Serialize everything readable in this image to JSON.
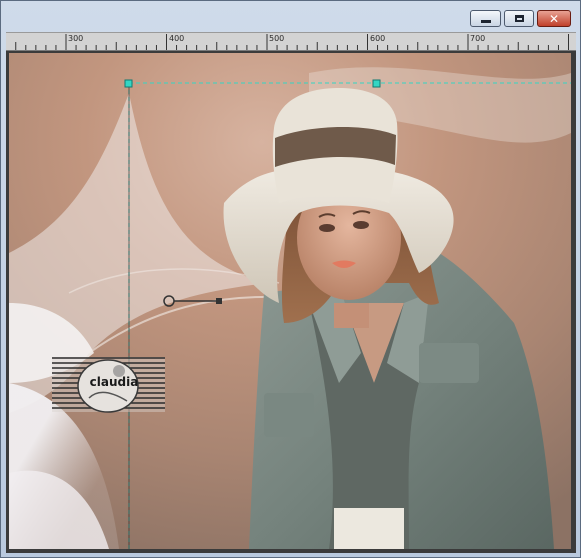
{
  "window": {
    "controls": {
      "minimize_icon": "minimize-icon",
      "maximize_icon": "maximize-icon",
      "close_icon": "close-icon",
      "close_glyph": "✕"
    }
  },
  "ruler": {
    "labels": [
      "300",
      "400",
      "500",
      "600",
      "700"
    ]
  },
  "canvas": {
    "watermark_text": "claudia",
    "colors": {
      "guide": "#33d6c4",
      "background_warm": "#b98a72",
      "background_light": "#e8e5e6"
    }
  }
}
